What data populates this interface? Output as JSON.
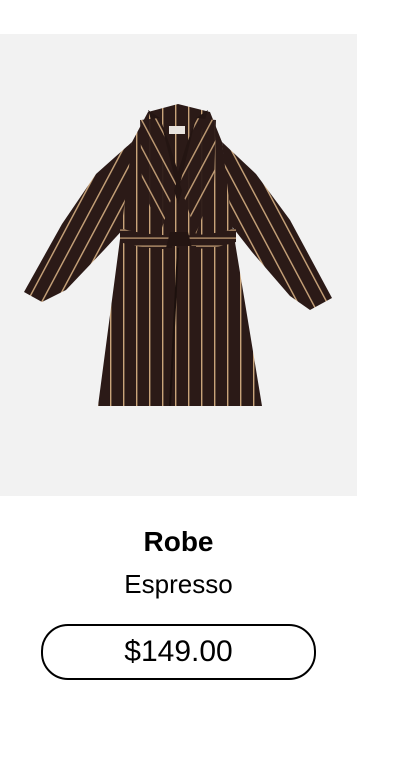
{
  "product": {
    "name": "Robe",
    "variant": "Espresso",
    "price": "$149.00",
    "image_alt": "Robe in Espresso"
  },
  "colors": {
    "image_background": "#f2f2f2",
    "robe": "#2b1a17",
    "stripe": "#c9a47a"
  }
}
